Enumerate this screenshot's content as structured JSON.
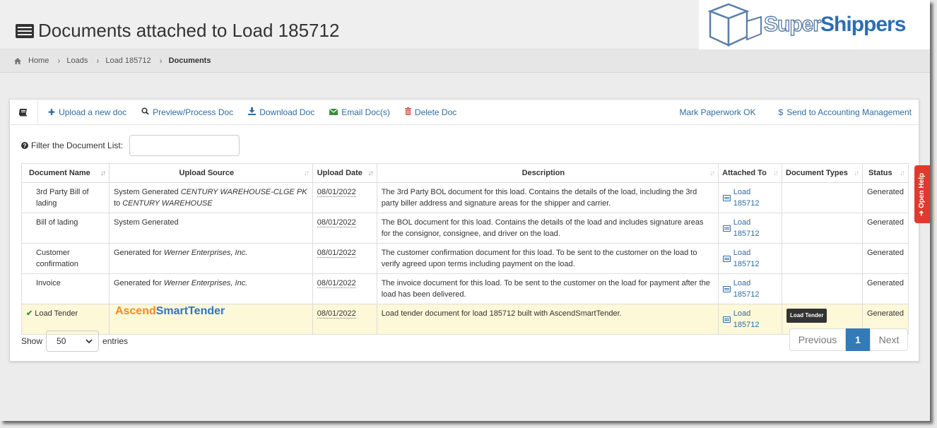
{
  "page": {
    "title": "Documents attached to Load 185712"
  },
  "logo": {
    "part1": "Super",
    "part2": "Shippers"
  },
  "breadcrumb": {
    "items": [
      "Home",
      "Loads",
      "Load 185712",
      "Documents"
    ]
  },
  "toolbar": {
    "upload": "Upload a new doc",
    "preview": "Preview/Process Doc",
    "download": "Download Doc",
    "email": "Email Doc(s)",
    "delete": "Delete Doc",
    "mark_ok": "Mark Paperwork OK",
    "send_accounting": "Send to Accounting Management"
  },
  "filter": {
    "label": "Filter the Document List:",
    "value": ""
  },
  "table": {
    "headers": [
      "Document Name",
      "Upload Source",
      "Upload Date",
      "Description",
      "Attached To",
      "Document Types",
      "Status"
    ],
    "rows": [
      {
        "name": "3rd Party Bill of lading",
        "source_prefix": "System Generated",
        "source_from": "CENTURY WAREHOUSE-CLGE PK",
        "source_to_word": "to",
        "source_to": "CENTURY WAREHOUSE",
        "date": "08/01/2022",
        "description": "The 3rd Party BOL document for this load. Contains the details of the load, including the 3rd party biller address and signature areas for the shipper and carrier.",
        "attached": "Load 185712",
        "status": "Generated"
      },
      {
        "name": "Bill of lading",
        "source_prefix": "System Generated",
        "date": "08/01/2022",
        "description": "The BOL document for this load. Contains the details of the load and includes signature areas for the consignor, consignee, and driver on the load.",
        "attached": "Load 185712",
        "status": "Generated"
      },
      {
        "name": "Customer confirmation",
        "source_prefix": "Generated for",
        "source_company": "Werner Enterprises, Inc.",
        "date": "08/01/2022",
        "description": "The customer confirmation document for this load. To be sent to the customer on the load to verify agreed upon terms including payment on the load.",
        "attached": "Load 185712",
        "status": "Generated"
      },
      {
        "name": "Invoice",
        "source_prefix": "Generated for",
        "source_company": "Werner Enterprises, Inc.",
        "date": "08/01/2022",
        "description": "The invoice document for this load. To be sent to the customer on the load for payment after the load has been delivered.",
        "attached": "Load 185712",
        "status": "Generated"
      },
      {
        "name": "Load Tender",
        "source_brand_a": "Ascend",
        "source_brand_b": "SmartTender",
        "date": "08/01/2022",
        "description": "Load tender document for load 185712 built with AscendSmartTender.",
        "attached": "Load 185712",
        "doc_type": "Load Tender",
        "status": "Generated"
      }
    ]
  },
  "footer": {
    "show_label": "Show",
    "entries_value": "50",
    "entries_label": "entries",
    "prev": "Previous",
    "current_page": "1",
    "next": "Next"
  },
  "help": {
    "label": "Open Help"
  },
  "colors": {
    "link": "#2e6da4",
    "highlight_row": "#fcf8d8",
    "help_tab": "#e03a2e",
    "page_active": "#337ab7"
  }
}
